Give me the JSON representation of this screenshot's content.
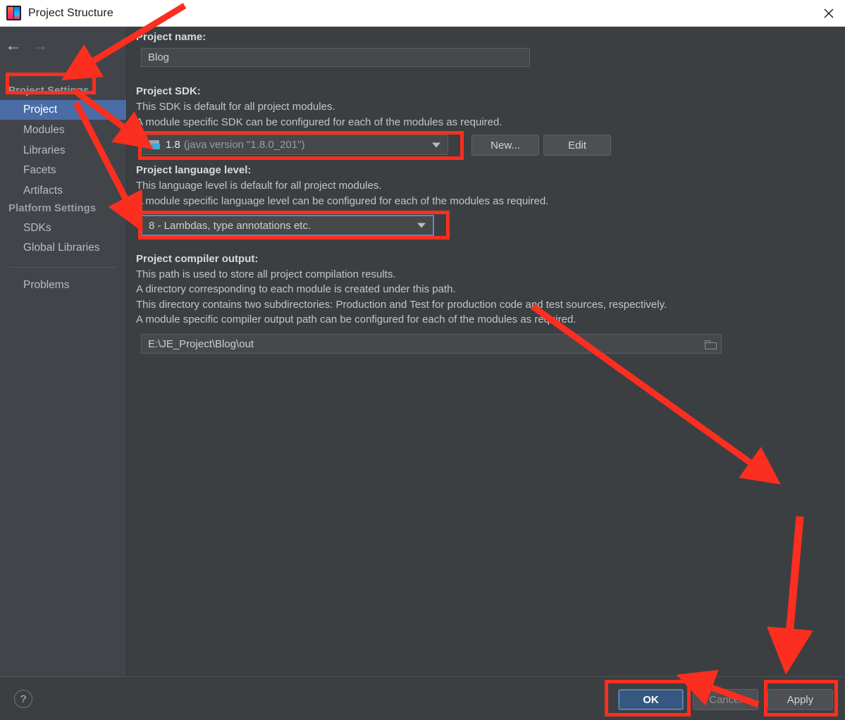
{
  "window": {
    "title": "Project Structure",
    "logo_icon": "intellij-idea-logo",
    "close_icon": "close-icon"
  },
  "sidebar": {
    "back_icon": "arrow-left-icon",
    "forward_icon": "arrow-right-icon",
    "groups": [
      {
        "label": "Project Settings"
      },
      {
        "label": "Platform Settings"
      }
    ],
    "items": [
      {
        "label": "Project",
        "selected": true
      },
      {
        "label": "Modules",
        "selected": false
      },
      {
        "label": "Libraries",
        "selected": false
      },
      {
        "label": "Facets",
        "selected": false
      },
      {
        "label": "Artifacts",
        "selected": false
      },
      {
        "label": "SDKs",
        "selected": false
      },
      {
        "label": "Global Libraries",
        "selected": false
      },
      {
        "label": "Problems",
        "selected": false
      }
    ]
  },
  "main": {
    "project_name": {
      "label": "Project name:",
      "value": "Blog"
    },
    "project_sdk": {
      "label": "Project SDK:",
      "desc1": "This SDK is default for all project modules.",
      "desc2": "A module specific SDK can be configured for each of the modules as required.",
      "value_main": "1.8",
      "value_sub": "(java version \"1.8.0_201\")",
      "icon": "sdk-folder-icon",
      "dropdown_icon": "chevron-down-icon",
      "new_button": "New...",
      "edit_button": "Edit"
    },
    "language_level": {
      "label": "Project language level:",
      "desc1": "This language level is default for all project modules.",
      "desc2": "A module specific language level can be configured for each of the modules as required.",
      "value": "8 - Lambdas, type annotations etc.",
      "dropdown_icon": "chevron-down-icon"
    },
    "compiler_output": {
      "label": "Project compiler output:",
      "desc1": "This path is used to store all project compilation results.",
      "desc2": "A directory corresponding to each module is created under this path.",
      "desc3": "This directory contains two subdirectories: Production and Test for production code and test sources, respectively.",
      "desc4": "A module specific compiler output path can be configured for each of the modules as required.",
      "value": "E:\\JE_Project\\Blog\\out",
      "browse_icon": "folder-browse-icon"
    }
  },
  "footer": {
    "help_label": "?",
    "help_icon": "help-icon",
    "ok_label": "OK",
    "cancel_label": "Cancel",
    "apply_label": "Apply"
  },
  "colors": {
    "background": "#3c3f41",
    "sidebar": "#41454a",
    "selection": "#4a6da7",
    "primary_button": "#365880",
    "annotation_red": "#fc2e20",
    "field_background": "#45494a"
  }
}
